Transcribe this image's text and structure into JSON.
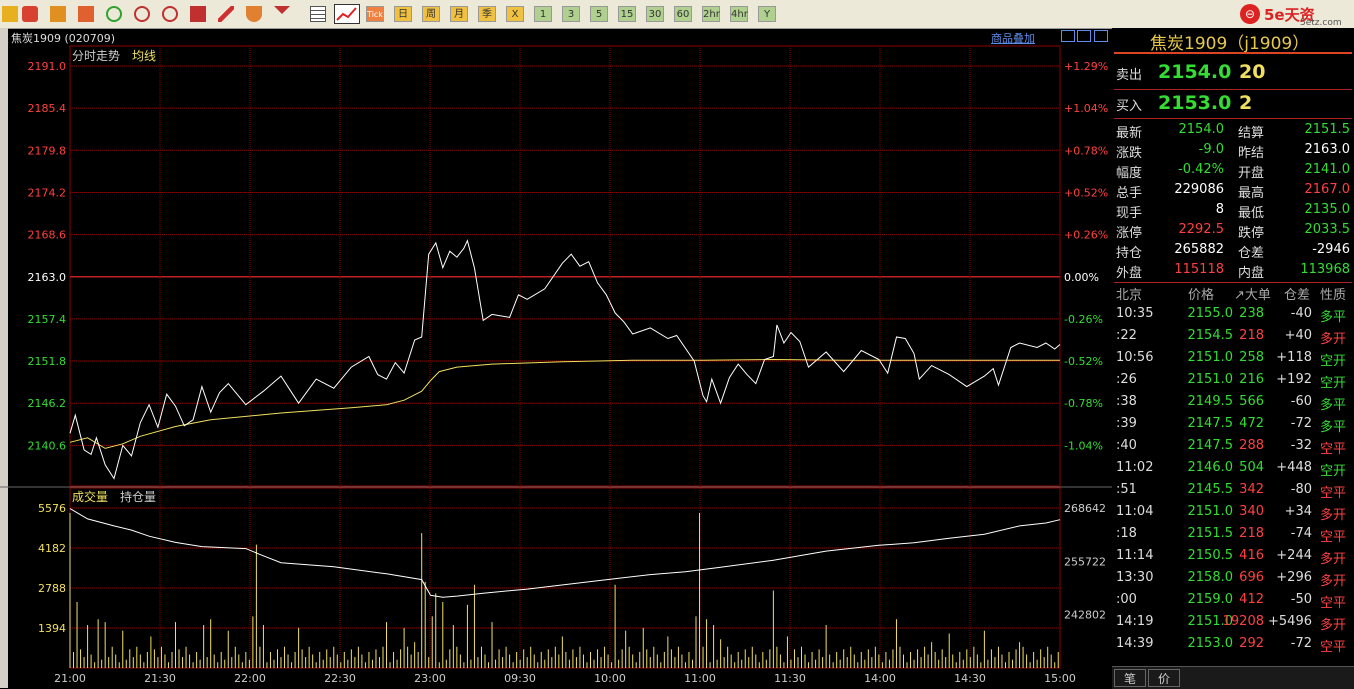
{
  "toolbar": {
    "periods": [
      "Tick",
      "日",
      "周",
      "月",
      "季",
      "X",
      "1",
      "3",
      "5",
      "15",
      "30",
      "60",
      "2hr",
      "4hr",
      "Y"
    ]
  },
  "logo": {
    "mark": "⊖",
    "brand": "5e天资",
    "domain": "5etz.com"
  },
  "chart_header": {
    "title": "焦炭1909 (020709)",
    "overlay": "商品叠加"
  },
  "colors": {
    "price": "#ffffff",
    "avg": "#f0e060",
    "up": "#ff4040",
    "down": "#33dd33",
    "flat": "#ffffff",
    "grid": "#8b0000",
    "volume": "#f0e060",
    "oi": "#ffffff"
  },
  "chart_data": [
    {
      "type": "line",
      "title": "分时走势",
      "series": [
        {
          "name": "均线"
        }
      ],
      "ylim": [
        2135.2,
        2191.0
      ],
      "prev_settle": 2163.0,
      "left_ticks": [
        "2191.0",
        "2185.4",
        "2179.8",
        "2174.2",
        "2168.6",
        "2163.0",
        "2157.4",
        "2151.8",
        "2146.2",
        "2140.6"
      ],
      "right_ticks": [
        "+1.29%",
        "+1.04%",
        "+0.78%",
        "+0.52%",
        "+0.26%",
        "0.00%",
        "-0.26%",
        "-0.52%",
        "-0.78%",
        "-1.04%"
      ],
      "x_ticks": [
        "21:00",
        "21:30",
        "22:00",
        "22:30",
        "23:00",
        "09:30",
        "10:00",
        "11:00",
        "11:30",
        "14:00",
        "14:30",
        "15:00"
      ],
      "price_keypoints": [
        [
          0,
          2142.2
        ],
        [
          3,
          2144.6
        ],
        [
          8,
          2140.0
        ],
        [
          12,
          2139.4
        ],
        [
          15,
          2141.6
        ],
        [
          20,
          2138.0
        ],
        [
          25,
          2136.2
        ],
        [
          30,
          2140.6
        ],
        [
          35,
          2139.2
        ],
        [
          40,
          2143.6
        ],
        [
          45,
          2146.0
        ],
        [
          50,
          2143.0
        ],
        [
          55,
          2147.4
        ],
        [
          60,
          2145.8
        ],
        [
          65,
          2143.2
        ],
        [
          70,
          2144.0
        ],
        [
          75,
          2148.4
        ],
        [
          80,
          2145.0
        ],
        [
          85,
          2147.6
        ],
        [
          90,
          2148.8
        ],
        [
          95,
          2147.4
        ],
        [
          100,
          2146.0
        ],
        [
          110,
          2147.8
        ],
        [
          120,
          2149.8
        ],
        [
          130,
          2146.2
        ],
        [
          140,
          2149.4
        ],
        [
          150,
          2148.2
        ],
        [
          160,
          2151.0
        ],
        [
          170,
          2152.4
        ],
        [
          175,
          2150.0
        ],
        [
          180,
          2149.4
        ],
        [
          185,
          2151.6
        ],
        [
          190,
          2150.2
        ],
        [
          196,
          2154.6
        ],
        [
          200,
          2155.0
        ],
        [
          204,
          2166.0
        ],
        [
          208,
          2167.5
        ],
        [
          212,
          2164.2
        ],
        [
          216,
          2166.4
        ],
        [
          220,
          2165.6
        ],
        [
          224,
          2166.8
        ],
        [
          226,
          2167.8
        ],
        [
          230,
          2164.2
        ],
        [
          235,
          2157.2
        ],
        [
          240,
          2158.0
        ],
        [
          250,
          2157.6
        ],
        [
          255,
          2160.6
        ],
        [
          260,
          2160.0
        ],
        [
          270,
          2161.4
        ],
        [
          280,
          2164.8
        ],
        [
          285,
          2166.0
        ],
        [
          290,
          2164.4
        ],
        [
          295,
          2165.0
        ],
        [
          300,
          2162.2
        ],
        [
          305,
          2160.6
        ],
        [
          310,
          2158.2
        ],
        [
          315,
          2157.0
        ],
        [
          320,
          2155.4
        ],
        [
          330,
          2156.2
        ],
        [
          340,
          2154.8
        ],
        [
          345,
          2155.2
        ],
        [
          355,
          2151.8
        ],
        [
          360,
          2147.2
        ],
        [
          362,
          2146.4
        ],
        [
          365,
          2149.4
        ],
        [
          370,
          2146.2
        ],
        [
          375,
          2149.6
        ],
        [
          380,
          2151.4
        ],
        [
          385,
          2150.0
        ],
        [
          390,
          2148.8
        ],
        [
          395,
          2152.0
        ],
        [
          400,
          2152.4
        ],
        [
          402,
          2156.6
        ],
        [
          406,
          2154.2
        ],
        [
          410,
          2155.6
        ],
        [
          415,
          2154.4
        ],
        [
          420,
          2151.0
        ],
        [
          430,
          2153.0
        ],
        [
          440,
          2150.4
        ],
        [
          450,
          2153.2
        ],
        [
          460,
          2152.0
        ],
        [
          465,
          2150.2
        ],
        [
          470,
          2155.0
        ],
        [
          475,
          2154.8
        ],
        [
          480,
          2152.8
        ],
        [
          483,
          2149.4
        ],
        [
          490,
          2151.2
        ],
        [
          500,
          2150.0
        ],
        [
          510,
          2148.4
        ],
        [
          520,
          2149.8
        ],
        [
          525,
          2150.8
        ],
        [
          528,
          2148.6
        ],
        [
          535,
          2153.6
        ],
        [
          540,
          2154.2
        ],
        [
          550,
          2153.6
        ],
        [
          555,
          2154.2
        ],
        [
          560,
          2153.4
        ],
        [
          563,
          2154.0
        ]
      ],
      "avg_keypoints": [
        [
          0,
          2141.0
        ],
        [
          10,
          2141.6
        ],
        [
          20,
          2140.2
        ],
        [
          30,
          2140.8
        ],
        [
          40,
          2141.8
        ],
        [
          60,
          2143.1
        ],
        [
          80,
          2144.0
        ],
        [
          120,
          2144.9
        ],
        [
          160,
          2145.6
        ],
        [
          180,
          2146.0
        ],
        [
          190,
          2146.6
        ],
        [
          200,
          2147.8
        ],
        [
          205,
          2149.2
        ],
        [
          210,
          2150.4
        ],
        [
          220,
          2151.0
        ],
        [
          240,
          2151.4
        ],
        [
          280,
          2151.7
        ],
        [
          320,
          2151.9
        ],
        [
          360,
          2151.9
        ],
        [
          400,
          2152.0
        ],
        [
          440,
          2151.9
        ],
        [
          480,
          2151.9
        ],
        [
          563,
          2151.9
        ]
      ]
    },
    {
      "type": "bar",
      "series": [
        {
          "name": "成交量"
        },
        {
          "name": "持仓量"
        }
      ],
      "ylim": [
        0,
        5576
      ],
      "left_ticks": [
        "5576",
        "4182",
        "2788",
        "1394"
      ],
      "oi_ylim": [
        229882,
        268642
      ],
      "right_ticks": [
        "268642",
        "255722",
        "242802"
      ],
      "volume_spikes": [
        [
          0,
          5400
        ],
        [
          4,
          2300
        ],
        [
          10,
          1500
        ],
        [
          15,
          1700
        ],
        [
          20,
          1600
        ],
        [
          30,
          1300
        ],
        [
          45,
          1100
        ],
        [
          60,
          1600
        ],
        [
          75,
          1500
        ],
        [
          80,
          1700
        ],
        [
          90,
          1300
        ],
        [
          103,
          1800
        ],
        [
          105,
          4300
        ],
        [
          110,
          1500
        ],
        [
          130,
          1400
        ],
        [
          180,
          1600
        ],
        [
          190,
          1400
        ],
        [
          196,
          900
        ],
        [
          199,
          4700
        ],
        [
          202,
          3000
        ],
        [
          205,
          1800
        ],
        [
          208,
          2600
        ],
        [
          212,
          2300
        ],
        [
          218,
          1500
        ],
        [
          225,
          2200
        ],
        [
          230,
          2900
        ],
        [
          240,
          1600
        ],
        [
          280,
          1100
        ],
        [
          310,
          2900
        ],
        [
          315,
          1300
        ],
        [
          325,
          1400
        ],
        [
          340,
          1100
        ],
        [
          355,
          1800
        ],
        [
          358,
          5400
        ],
        [
          362,
          1700
        ],
        [
          366,
          1500
        ],
        [
          370,
          1000
        ],
        [
          400,
          2700
        ],
        [
          408,
          1100
        ],
        [
          430,
          1500
        ],
        [
          470,
          1700
        ],
        [
          490,
          900
        ],
        [
          500,
          1200
        ],
        [
          520,
          1300
        ],
        [
          540,
          900
        ],
        [
          563,
          2100
        ]
      ],
      "oi_keypoints": [
        [
          0,
          268500
        ],
        [
          10,
          266000
        ],
        [
          25,
          264300
        ],
        [
          35,
          263300
        ],
        [
          45,
          261800
        ],
        [
          60,
          260300
        ],
        [
          75,
          259300
        ],
        [
          100,
          258800
        ],
        [
          108,
          257400
        ],
        [
          120,
          255400
        ],
        [
          150,
          254400
        ],
        [
          180,
          252700
        ],
        [
          200,
          251300
        ],
        [
          205,
          247500
        ],
        [
          212,
          247000
        ],
        [
          220,
          247300
        ],
        [
          235,
          248000
        ],
        [
          260,
          249000
        ],
        [
          300,
          251000
        ],
        [
          330,
          252500
        ],
        [
          350,
          253200
        ],
        [
          370,
          254300
        ],
        [
          400,
          256000
        ],
        [
          430,
          258200
        ],
        [
          460,
          259600
        ],
        [
          480,
          260200
        ],
        [
          500,
          261300
        ],
        [
          520,
          262300
        ],
        [
          540,
          264300
        ],
        [
          555,
          265000
        ],
        [
          563,
          265800
        ]
      ]
    }
  ],
  "quote": {
    "title": "焦炭1909（j1909）",
    "sell_label": "卖出",
    "sell_price": "2154.0",
    "sell_vol": "20",
    "buy_label": "买入",
    "buy_price": "2153.0",
    "buy_vol": "2",
    "stats": [
      {
        "l1": "最新",
        "v1": "2154.0",
        "c1": "down",
        "l2": "结算",
        "v2": "2151.5",
        "c2": "down"
      },
      {
        "l1": "涨跌",
        "v1": "-9.0",
        "c1": "down",
        "l2": "昨结",
        "v2": "2163.0",
        "c2": "flat"
      },
      {
        "l1": "幅度",
        "v1": "-0.42%",
        "c1": "down",
        "l2": "开盘",
        "v2": "2141.0",
        "c2": "down"
      },
      {
        "l1": "总手",
        "v1": "229086",
        "c1": "flat",
        "l2": "最高",
        "v2": "2167.0",
        "c2": "up"
      },
      {
        "l1": "现手",
        "v1": "8",
        "c1": "flat",
        "l2": "最低",
        "v2": "2135.0",
        "c2": "down"
      },
      {
        "l1": "涨停",
        "v1": "2292.5",
        "c1": "up",
        "l2": "跌停",
        "v2": "2033.5",
        "c2": "down"
      },
      {
        "l1": "持仓",
        "v1": "265882",
        "c1": "flat",
        "l2": "仓差",
        "v2": "-2946",
        "c2": "flat"
      },
      {
        "l1": "外盘",
        "v1": "115118",
        "c1": "up",
        "l2": "内盘",
        "v2": "113968",
        "c2": "down"
      }
    ],
    "ticks_header": {
      "time": "北京",
      "price": "价格",
      "vol": "↗大单",
      "chg": "仓差",
      "nature": "性质"
    },
    "ticks": [
      {
        "time": "10:35",
        "price": "2155.0",
        "vol": "238",
        "chg": "-40",
        "nature": "多平",
        "vc": "down",
        "nc": "down"
      },
      {
        "time": ":22",
        "price": "2154.5",
        "vol": "218",
        "chg": "+40",
        "nature": "多开",
        "vc": "up",
        "nc": "up"
      },
      {
        "time": "10:56",
        "price": "2151.0",
        "vol": "258",
        "chg": "+118",
        "nature": "空开",
        "vc": "down",
        "nc": "down"
      },
      {
        "time": ":26",
        "price": "2151.0",
        "vol": "216",
        "chg": "+192",
        "nature": "空开",
        "vc": "down",
        "nc": "down"
      },
      {
        "time": ":38",
        "price": "2149.5",
        "vol": "566",
        "chg": "-60",
        "nature": "多平",
        "vc": "down",
        "nc": "down"
      },
      {
        "time": ":39",
        "price": "2147.5",
        "vol": "472",
        "chg": "-72",
        "nature": "多平",
        "vc": "down",
        "nc": "down"
      },
      {
        "time": ":40",
        "price": "2147.5",
        "vol": "288",
        "chg": "-32",
        "nature": "空平",
        "vc": "up",
        "nc": "up"
      },
      {
        "time": "11:02",
        "price": "2146.0",
        "vol": "504",
        "chg": "+448",
        "nature": "空开",
        "vc": "down",
        "nc": "down"
      },
      {
        "time": ":51",
        "price": "2145.5",
        "vol": "342",
        "chg": "-80",
        "nature": "空平",
        "vc": "up",
        "nc": "up"
      },
      {
        "time": "11:04",
        "price": "2151.0",
        "vol": "340",
        "chg": "+34",
        "nature": "多开",
        "vc": "up",
        "nc": "up"
      },
      {
        "time": ":18",
        "price": "2151.5",
        "vol": "218",
        "chg": "-74",
        "nature": "空平",
        "vc": "up",
        "nc": "up"
      },
      {
        "time": "11:14",
        "price": "2150.5",
        "vol": "416",
        "chg": "+244",
        "nature": "多开",
        "vc": "up",
        "nc": "up"
      },
      {
        "time": "13:30",
        "price": "2158.0",
        "vol": "696",
        "chg": "+296",
        "nature": "多开",
        "vc": "up",
        "nc": "up"
      },
      {
        "time": ":00",
        "price": "2159.0",
        "vol": "412",
        "chg": "-50",
        "nature": "空平",
        "vc": "up",
        "nc": "up"
      },
      {
        "time": "14:19",
        "price": "2151.0",
        "vol": "19208",
        "chg": "+5496",
        "nature": "多开",
        "vc": "up",
        "nc": "up"
      },
      {
        "time": "14:39",
        "price": "2153.0",
        "vol": "292",
        "chg": "-72",
        "nature": "空平",
        "vc": "up",
        "nc": "up"
      }
    ],
    "tabs": [
      "笔",
      "价"
    ]
  }
}
